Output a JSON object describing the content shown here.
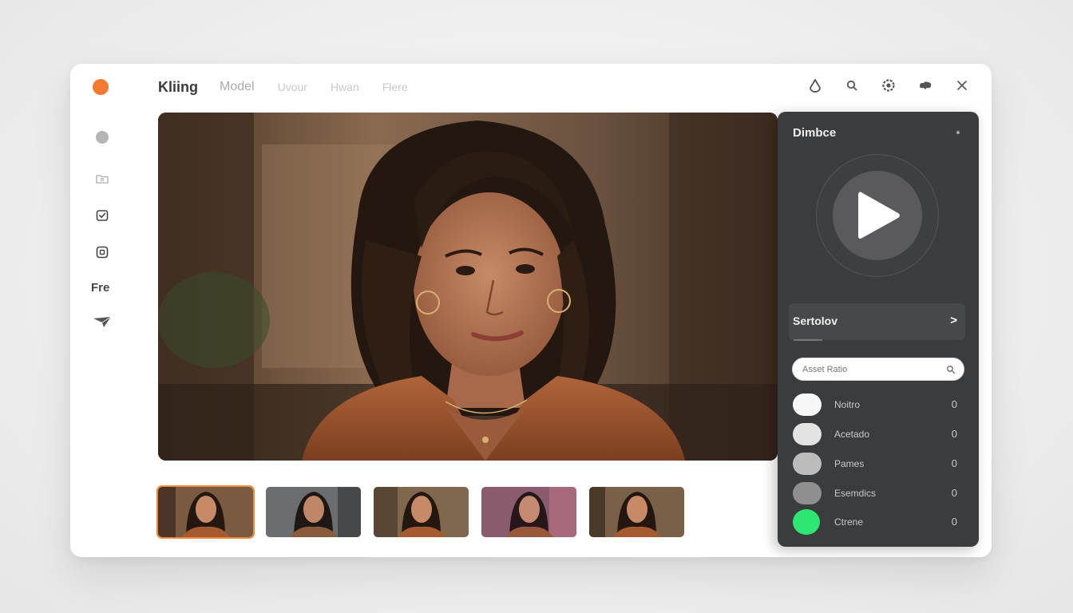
{
  "topbar": {
    "brand": "Kliing",
    "nav": [
      "Model",
      "Uvour",
      "Hwan",
      "Flere"
    ]
  },
  "topbar_icons": [
    "drop-icon",
    "search-icon",
    "settings-icon",
    "cloud-icon",
    "close-icon"
  ],
  "rail": {
    "text_item": "Fre",
    "icons": [
      "circle-icon",
      "folder-icon",
      "calendar-check-icon",
      "square-icon",
      "send-icon",
      "star-icon"
    ]
  },
  "thumbnails": [
    {
      "active": true
    },
    {
      "active": false
    },
    {
      "active": false
    },
    {
      "active": false
    },
    {
      "active": false
    }
  ],
  "panel": {
    "title": "Dimbce",
    "select_label": "Sertolov",
    "search_placeholder": "Asset Ratio",
    "options": [
      {
        "name": "Noitro",
        "count": "0",
        "color": "#f7f7f7"
      },
      {
        "name": "Acetado",
        "count": "0",
        "color": "#e3e3e3"
      },
      {
        "name": "Pames",
        "count": "0",
        "color": "#bcbcbc"
      },
      {
        "name": "Esemdics",
        "count": "0",
        "color": "#8f8f8f"
      },
      {
        "name": "Ctrene",
        "count": "0",
        "color": "#2ee672"
      }
    ]
  },
  "colors": {
    "accent": "#f47a34",
    "panel_bg": "#3b3c3e",
    "active_thumb_border": "#f08a3c",
    "green": "#2ee672"
  }
}
